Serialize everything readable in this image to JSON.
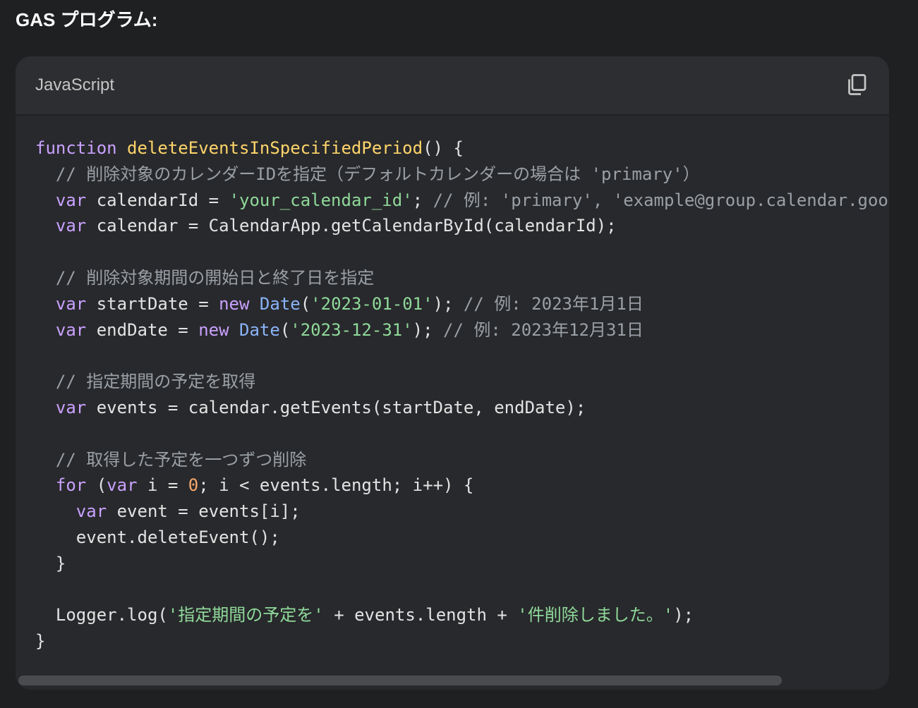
{
  "page": {
    "heading": "GAS プログラム:"
  },
  "code_block": {
    "language": "JavaScript",
    "copy_icon": "copy-icon",
    "lines": [
      {
        "tokens": [
          {
            "t": "function",
            "c": "kw"
          },
          {
            "t": " ",
            "c": "txt"
          },
          {
            "t": "deleteEventsInSpecifiedPeriod",
            "c": "fn"
          },
          {
            "t": "() {",
            "c": "txt"
          }
        ]
      },
      {
        "tokens": [
          {
            "t": "  // 削除対象のカレンダーIDを指定（デフォルトカレンダーの場合は 'primary'）",
            "c": "cmt"
          }
        ]
      },
      {
        "tokens": [
          {
            "t": "  ",
            "c": "txt"
          },
          {
            "t": "var",
            "c": "kw"
          },
          {
            "t": " calendarId = ",
            "c": "txt"
          },
          {
            "t": "'your_calendar_id'",
            "c": "str"
          },
          {
            "t": "; ",
            "c": "txt"
          },
          {
            "t": "// 例: 'primary', 'example@group.calendar.google.com'",
            "c": "cmt"
          }
        ]
      },
      {
        "tokens": [
          {
            "t": "  ",
            "c": "txt"
          },
          {
            "t": "var",
            "c": "kw"
          },
          {
            "t": " calendar = CalendarApp.getCalendarById(calendarId);",
            "c": "txt"
          }
        ]
      },
      {
        "tokens": [
          {
            "t": "",
            "c": "txt"
          }
        ]
      },
      {
        "tokens": [
          {
            "t": "  // 削除対象期間の開始日と終了日を指定",
            "c": "cmt"
          }
        ]
      },
      {
        "tokens": [
          {
            "t": "  ",
            "c": "txt"
          },
          {
            "t": "var",
            "c": "kw"
          },
          {
            "t": " startDate = ",
            "c": "txt"
          },
          {
            "t": "new",
            "c": "kw"
          },
          {
            "t": " ",
            "c": "txt"
          },
          {
            "t": "Date",
            "c": "cls"
          },
          {
            "t": "(",
            "c": "txt"
          },
          {
            "t": "'2023-01-01'",
            "c": "str"
          },
          {
            "t": "); ",
            "c": "txt"
          },
          {
            "t": "// 例: 2023年1月1日",
            "c": "cmt"
          }
        ]
      },
      {
        "tokens": [
          {
            "t": "  ",
            "c": "txt"
          },
          {
            "t": "var",
            "c": "kw"
          },
          {
            "t": " endDate = ",
            "c": "txt"
          },
          {
            "t": "new",
            "c": "kw"
          },
          {
            "t": " ",
            "c": "txt"
          },
          {
            "t": "Date",
            "c": "cls"
          },
          {
            "t": "(",
            "c": "txt"
          },
          {
            "t": "'2023-12-31'",
            "c": "str"
          },
          {
            "t": "); ",
            "c": "txt"
          },
          {
            "t": "// 例: 2023年12月31日",
            "c": "cmt"
          }
        ]
      },
      {
        "tokens": [
          {
            "t": "",
            "c": "txt"
          }
        ]
      },
      {
        "tokens": [
          {
            "t": "  // 指定期間の予定を取得",
            "c": "cmt"
          }
        ]
      },
      {
        "tokens": [
          {
            "t": "  ",
            "c": "txt"
          },
          {
            "t": "var",
            "c": "kw"
          },
          {
            "t": " events = calendar.getEvents(startDate, endDate);",
            "c": "txt"
          }
        ]
      },
      {
        "tokens": [
          {
            "t": "",
            "c": "txt"
          }
        ]
      },
      {
        "tokens": [
          {
            "t": "  // 取得した予定を一つずつ削除",
            "c": "cmt"
          }
        ]
      },
      {
        "tokens": [
          {
            "t": "  ",
            "c": "txt"
          },
          {
            "t": "for",
            "c": "kw"
          },
          {
            "t": " (",
            "c": "txt"
          },
          {
            "t": "var",
            "c": "kw"
          },
          {
            "t": " i = ",
            "c": "txt"
          },
          {
            "t": "0",
            "c": "num"
          },
          {
            "t": "; i < events.length; i++) {",
            "c": "txt"
          }
        ]
      },
      {
        "tokens": [
          {
            "t": "    ",
            "c": "txt"
          },
          {
            "t": "var",
            "c": "kw"
          },
          {
            "t": " event = events[i];",
            "c": "txt"
          }
        ]
      },
      {
        "tokens": [
          {
            "t": "    event.deleteEvent();",
            "c": "txt"
          }
        ]
      },
      {
        "tokens": [
          {
            "t": "  }",
            "c": "txt"
          }
        ]
      },
      {
        "tokens": [
          {
            "t": "",
            "c": "txt"
          }
        ]
      },
      {
        "tokens": [
          {
            "t": "  Logger.log(",
            "c": "txt"
          },
          {
            "t": "'指定期間の予定を'",
            "c": "str"
          },
          {
            "t": " + events.length + ",
            "c": "txt"
          },
          {
            "t": "'件削除しました。'",
            "c": "str"
          },
          {
            "t": ");",
            "c": "txt"
          }
        ]
      },
      {
        "tokens": [
          {
            "t": "}",
            "c": "txt"
          }
        ]
      }
    ]
  },
  "colors": {
    "page_background": "#1f2022",
    "card_background": "#28292c",
    "header_background": "#2d2e31",
    "keyword": "#c9a1ff",
    "function_name": "#ffd56a",
    "string": "#8fd99a",
    "number": "#f9a86a",
    "comment": "#9aa0a6",
    "class_name": "#8ab4f8",
    "plain_text": "#e3e3e3"
  },
  "scrollbar": {
    "horizontal_visible_fraction": 0.88
  }
}
